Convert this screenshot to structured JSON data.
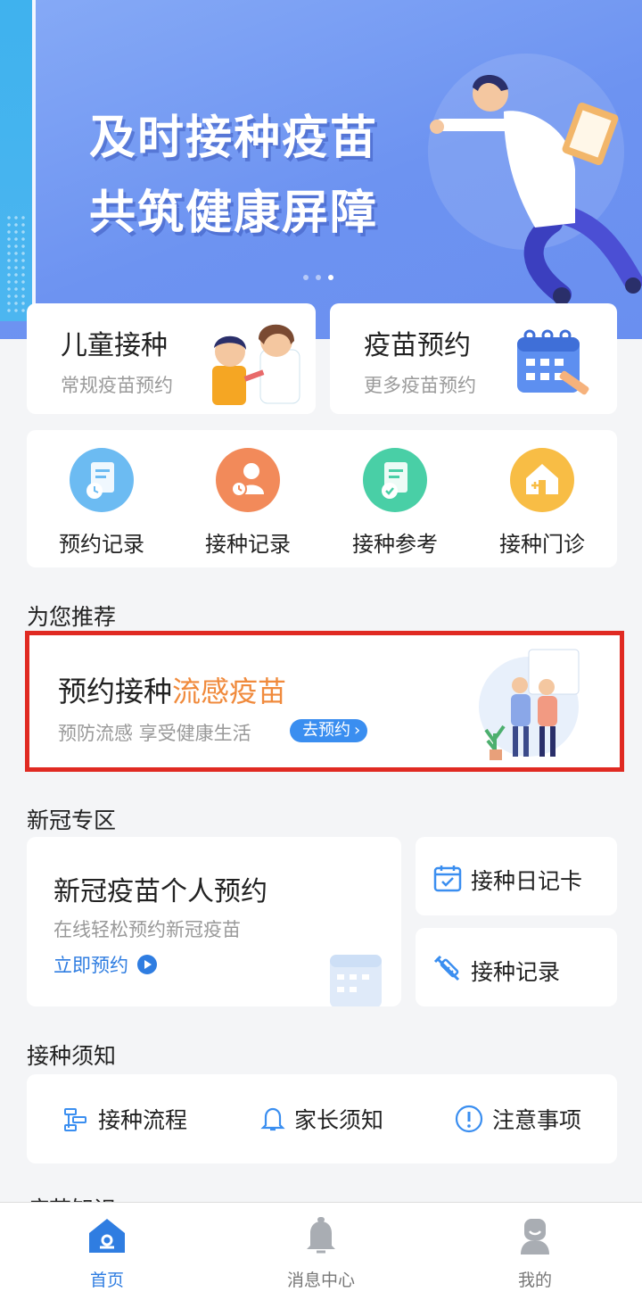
{
  "banner": {
    "line1": "及时接种疫苗",
    "line2": "共筑健康屏障",
    "pages": 3,
    "active_page": 3
  },
  "quick_cards": [
    {
      "title": "儿童接种",
      "subtitle": "常规疫苗预约"
    },
    {
      "title": "疫苗预约",
      "subtitle": "更多疫苗预约"
    }
  ],
  "menu": [
    {
      "label": "预约记录",
      "icon": "appointment-record-icon",
      "color": "#4aa8ee"
    },
    {
      "label": "接种记录",
      "icon": "vaccination-record-icon",
      "color": "#f07a4a"
    },
    {
      "label": "接种参考",
      "icon": "vaccination-reference-icon",
      "color": "#3fc9a0"
    },
    {
      "label": "接种门诊",
      "icon": "clinic-icon",
      "color": "#f6b23c"
    }
  ],
  "recommend": {
    "section_title": "为您推荐",
    "title_prefix": "预约接种",
    "title_highlight": "流感疫苗",
    "subtitle": "预防流感 享受健康生活",
    "button_label": "去预约"
  },
  "covid": {
    "section_title": "新冠专区",
    "main_title": "新冠疫苗个人预约",
    "main_subtitle": "在线轻松预约新冠疫苗",
    "main_link": "立即预约",
    "side_items": [
      {
        "label": "接种日记卡",
        "icon": "calendar-icon"
      },
      {
        "label": "接种记录",
        "icon": "syringe-icon"
      }
    ]
  },
  "notice": {
    "section_title": "接种须知",
    "items": [
      {
        "label": "接种流程",
        "icon": "process-icon"
      },
      {
        "label": "家长须知",
        "icon": "bell-icon"
      },
      {
        "label": "注意事项",
        "icon": "warning-icon"
      }
    ]
  },
  "next_section_title": "疫苗知识",
  "tabbar": [
    {
      "label": "首页",
      "icon": "home-icon",
      "active": true
    },
    {
      "label": "消息中心",
      "icon": "bell-icon",
      "active": false
    },
    {
      "label": "我的",
      "icon": "profile-icon",
      "active": false
    }
  ],
  "colors": {
    "accent": "#2f7de1",
    "highlight": "#f08a3c",
    "banner": "#6d93f1",
    "red_frame": "#e02a22"
  }
}
